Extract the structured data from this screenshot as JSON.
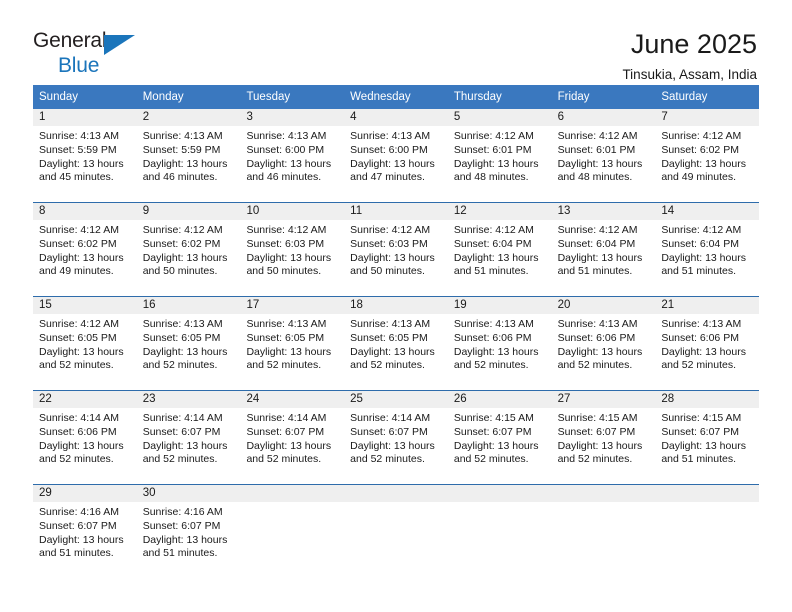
{
  "brand": {
    "name_part1": "General",
    "name_part2": "Blue",
    "triangle_color": "#1b75bb"
  },
  "header": {
    "title": "June 2025",
    "subtitle": "Tinsukia, Assam, India"
  },
  "theme": {
    "header_blue": "#3a78bf",
    "row_divider_blue": "#2e6cab",
    "daynum_band": "#efefef",
    "text": "#1a1a1a"
  },
  "calendar": {
    "weekdays": [
      "Sunday",
      "Monday",
      "Tuesday",
      "Wednesday",
      "Thursday",
      "Friday",
      "Saturday"
    ],
    "weeks": [
      [
        {
          "day": "1",
          "sunrise": "Sunrise: 4:13 AM",
          "sunset": "Sunset: 5:59 PM",
          "daylight1": "Daylight: 13 hours",
          "daylight2": "and 45 minutes."
        },
        {
          "day": "2",
          "sunrise": "Sunrise: 4:13 AM",
          "sunset": "Sunset: 5:59 PM",
          "daylight1": "Daylight: 13 hours",
          "daylight2": "and 46 minutes."
        },
        {
          "day": "3",
          "sunrise": "Sunrise: 4:13 AM",
          "sunset": "Sunset: 6:00 PM",
          "daylight1": "Daylight: 13 hours",
          "daylight2": "and 46 minutes."
        },
        {
          "day": "4",
          "sunrise": "Sunrise: 4:13 AM",
          "sunset": "Sunset: 6:00 PM",
          "daylight1": "Daylight: 13 hours",
          "daylight2": "and 47 minutes."
        },
        {
          "day": "5",
          "sunrise": "Sunrise: 4:12 AM",
          "sunset": "Sunset: 6:01 PM",
          "daylight1": "Daylight: 13 hours",
          "daylight2": "and 48 minutes."
        },
        {
          "day": "6",
          "sunrise": "Sunrise: 4:12 AM",
          "sunset": "Sunset: 6:01 PM",
          "daylight1": "Daylight: 13 hours",
          "daylight2": "and 48 minutes."
        },
        {
          "day": "7",
          "sunrise": "Sunrise: 4:12 AM",
          "sunset": "Sunset: 6:02 PM",
          "daylight1": "Daylight: 13 hours",
          "daylight2": "and 49 minutes."
        }
      ],
      [
        {
          "day": "8",
          "sunrise": "Sunrise: 4:12 AM",
          "sunset": "Sunset: 6:02 PM",
          "daylight1": "Daylight: 13 hours",
          "daylight2": "and 49 minutes."
        },
        {
          "day": "9",
          "sunrise": "Sunrise: 4:12 AM",
          "sunset": "Sunset: 6:02 PM",
          "daylight1": "Daylight: 13 hours",
          "daylight2": "and 50 minutes."
        },
        {
          "day": "10",
          "sunrise": "Sunrise: 4:12 AM",
          "sunset": "Sunset: 6:03 PM",
          "daylight1": "Daylight: 13 hours",
          "daylight2": "and 50 minutes."
        },
        {
          "day": "11",
          "sunrise": "Sunrise: 4:12 AM",
          "sunset": "Sunset: 6:03 PM",
          "daylight1": "Daylight: 13 hours",
          "daylight2": "and 50 minutes."
        },
        {
          "day": "12",
          "sunrise": "Sunrise: 4:12 AM",
          "sunset": "Sunset: 6:04 PM",
          "daylight1": "Daylight: 13 hours",
          "daylight2": "and 51 minutes."
        },
        {
          "day": "13",
          "sunrise": "Sunrise: 4:12 AM",
          "sunset": "Sunset: 6:04 PM",
          "daylight1": "Daylight: 13 hours",
          "daylight2": "and 51 minutes."
        },
        {
          "day": "14",
          "sunrise": "Sunrise: 4:12 AM",
          "sunset": "Sunset: 6:04 PM",
          "daylight1": "Daylight: 13 hours",
          "daylight2": "and 51 minutes."
        }
      ],
      [
        {
          "day": "15",
          "sunrise": "Sunrise: 4:12 AM",
          "sunset": "Sunset: 6:05 PM",
          "daylight1": "Daylight: 13 hours",
          "daylight2": "and 52 minutes."
        },
        {
          "day": "16",
          "sunrise": "Sunrise: 4:13 AM",
          "sunset": "Sunset: 6:05 PM",
          "daylight1": "Daylight: 13 hours",
          "daylight2": "and 52 minutes."
        },
        {
          "day": "17",
          "sunrise": "Sunrise: 4:13 AM",
          "sunset": "Sunset: 6:05 PM",
          "daylight1": "Daylight: 13 hours",
          "daylight2": "and 52 minutes."
        },
        {
          "day": "18",
          "sunrise": "Sunrise: 4:13 AM",
          "sunset": "Sunset: 6:05 PM",
          "daylight1": "Daylight: 13 hours",
          "daylight2": "and 52 minutes."
        },
        {
          "day": "19",
          "sunrise": "Sunrise: 4:13 AM",
          "sunset": "Sunset: 6:06 PM",
          "daylight1": "Daylight: 13 hours",
          "daylight2": "and 52 minutes."
        },
        {
          "day": "20",
          "sunrise": "Sunrise: 4:13 AM",
          "sunset": "Sunset: 6:06 PM",
          "daylight1": "Daylight: 13 hours",
          "daylight2": "and 52 minutes."
        },
        {
          "day": "21",
          "sunrise": "Sunrise: 4:13 AM",
          "sunset": "Sunset: 6:06 PM",
          "daylight1": "Daylight: 13 hours",
          "daylight2": "and 52 minutes."
        }
      ],
      [
        {
          "day": "22",
          "sunrise": "Sunrise: 4:14 AM",
          "sunset": "Sunset: 6:06 PM",
          "daylight1": "Daylight: 13 hours",
          "daylight2": "and 52 minutes."
        },
        {
          "day": "23",
          "sunrise": "Sunrise: 4:14 AM",
          "sunset": "Sunset: 6:07 PM",
          "daylight1": "Daylight: 13 hours",
          "daylight2": "and 52 minutes."
        },
        {
          "day": "24",
          "sunrise": "Sunrise: 4:14 AM",
          "sunset": "Sunset: 6:07 PM",
          "daylight1": "Daylight: 13 hours",
          "daylight2": "and 52 minutes."
        },
        {
          "day": "25",
          "sunrise": "Sunrise: 4:14 AM",
          "sunset": "Sunset: 6:07 PM",
          "daylight1": "Daylight: 13 hours",
          "daylight2": "and 52 minutes."
        },
        {
          "day": "26",
          "sunrise": "Sunrise: 4:15 AM",
          "sunset": "Sunset: 6:07 PM",
          "daylight1": "Daylight: 13 hours",
          "daylight2": "and 52 minutes."
        },
        {
          "day": "27",
          "sunrise": "Sunrise: 4:15 AM",
          "sunset": "Sunset: 6:07 PM",
          "daylight1": "Daylight: 13 hours",
          "daylight2": "and 52 minutes."
        },
        {
          "day": "28",
          "sunrise": "Sunrise: 4:15 AM",
          "sunset": "Sunset: 6:07 PM",
          "daylight1": "Daylight: 13 hours",
          "daylight2": "and 51 minutes."
        }
      ],
      [
        {
          "day": "29",
          "sunrise": "Sunrise: 4:16 AM",
          "sunset": "Sunset: 6:07 PM",
          "daylight1": "Daylight: 13 hours",
          "daylight2": "and 51 minutes."
        },
        {
          "day": "30",
          "sunrise": "Sunrise: 4:16 AM",
          "sunset": "Sunset: 6:07 PM",
          "daylight1": "Daylight: 13 hours",
          "daylight2": "and 51 minutes."
        },
        {
          "day": "",
          "sunrise": "",
          "sunset": "",
          "daylight1": "",
          "daylight2": ""
        },
        {
          "day": "",
          "sunrise": "",
          "sunset": "",
          "daylight1": "",
          "daylight2": ""
        },
        {
          "day": "",
          "sunrise": "",
          "sunset": "",
          "daylight1": "",
          "daylight2": ""
        },
        {
          "day": "",
          "sunrise": "",
          "sunset": "",
          "daylight1": "",
          "daylight2": ""
        },
        {
          "day": "",
          "sunrise": "",
          "sunset": "",
          "daylight1": "",
          "daylight2": ""
        }
      ]
    ]
  }
}
